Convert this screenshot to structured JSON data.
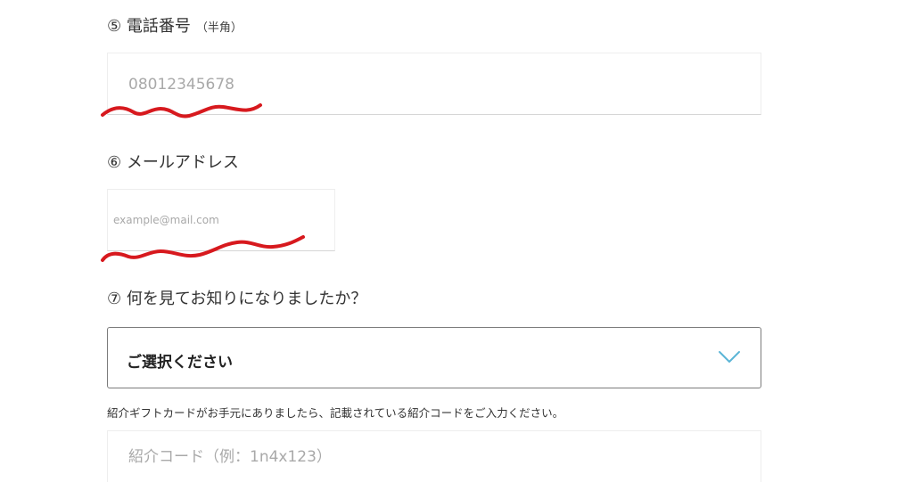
{
  "phone": {
    "label": "⑤ 電話番号",
    "sub_label": "（半角）",
    "placeholder": "08012345678"
  },
  "email": {
    "label": "⑥ メールアドレス",
    "placeholder": "example@mail.com"
  },
  "source": {
    "label": "⑦ 何を見てお知りになりましたか？",
    "selected": "ご選択ください"
  },
  "referral": {
    "hint": "紹介ギフトカードがお手元にありましたら、記載されている紹介コードをご入力ください。",
    "placeholder": "紹介コード（例：1n4x123）"
  },
  "colors": {
    "annotation": "#d7191e",
    "chevron": "#5bb5d6"
  },
  "icons": {
    "select_arrow": "chevron-down-icon"
  }
}
